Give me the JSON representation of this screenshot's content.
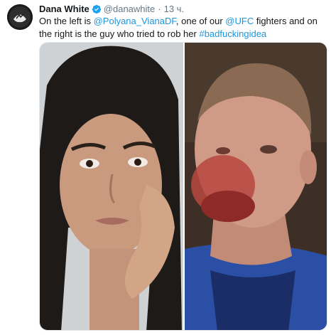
{
  "tweet": {
    "author": {
      "name": "Dana White",
      "handle": "@danawhite",
      "verified": true
    },
    "separator": "·",
    "time": "13 ч.",
    "text": {
      "part1": "On the left is ",
      "mention1": "@Polyana_VianaDF",
      "part2": ", one of our ",
      "mention2": "@UFC",
      "part3": " fighters and on the right is the guy who tried to rob her ",
      "hashtag": "#badfuckingidea"
    }
  },
  "colors": {
    "link": "#1b95e0",
    "verified": "#1da1f2",
    "secondary_text": "#657786",
    "primary_text": "#14171a"
  },
  "icons": {
    "verified": "verified-badge-icon"
  }
}
